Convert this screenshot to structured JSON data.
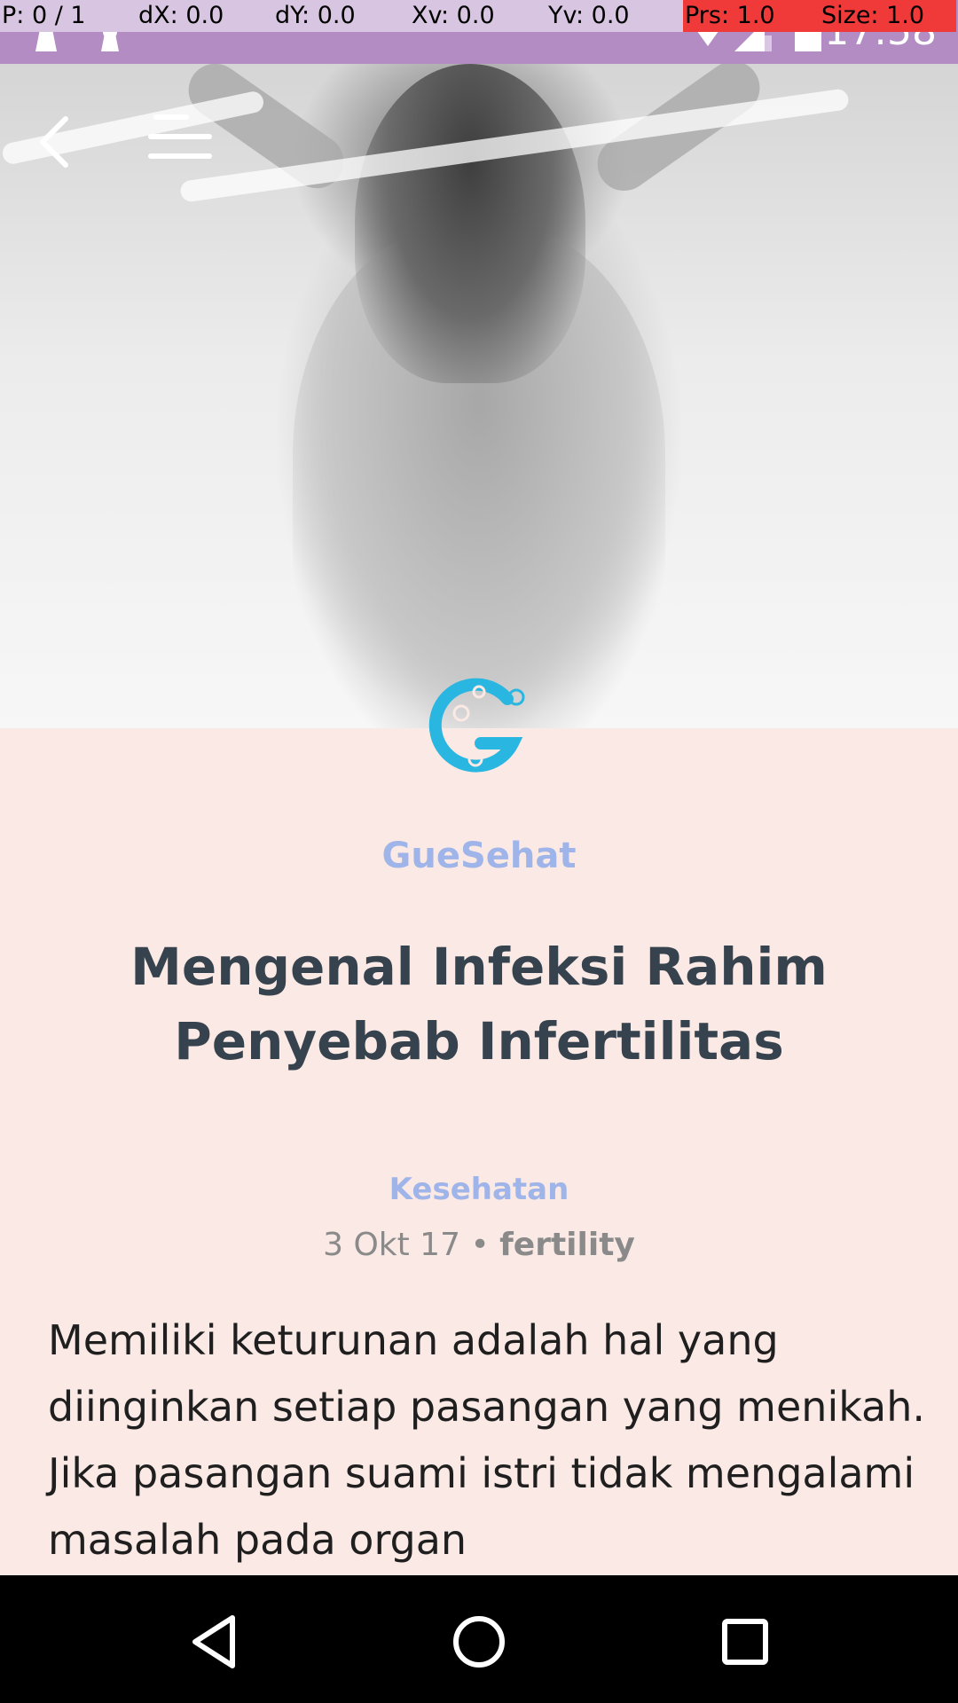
{
  "pointer_overlay": {
    "cells": [
      {
        "text": "P: 0 / 1",
        "highlight": false
      },
      {
        "text": "dX: 0.0",
        "highlight": false
      },
      {
        "text": "dY: 0.0",
        "highlight": false
      },
      {
        "text": "Xv: 0.0",
        "highlight": false
      },
      {
        "text": "Yv: 0.0",
        "highlight": false
      },
      {
        "text": "Prs: 1.0",
        "highlight": true
      },
      {
        "text": "Size: 1.0",
        "highlight": true
      }
    ]
  },
  "status_bar": {
    "time": "17:58",
    "color": "#b48cc4"
  },
  "article": {
    "brand": "GueSehat",
    "title": "Mengenal Infeksi Rahim Penyebab Infertilitas",
    "category": "Kesehatan",
    "date": "3 Okt 17",
    "separator": "•",
    "tag": "fertility",
    "body": "Memiliki keturunan adalah hal yang diinginkan setiap pasangan yang menikah. Jika pasangan suami istri tidak mengalami masalah pada organ"
  },
  "colors": {
    "background": "#fae9e4",
    "accent": "#9fb4e8",
    "title": "#36434e",
    "logo": "#29b6e0"
  },
  "icons": {
    "back": "back-arrow-icon",
    "menu": "hamburger-menu-icon",
    "logo": "guesehat-logo-icon",
    "nav_back": "nav-back-icon",
    "nav_home": "nav-home-icon",
    "nav_recents": "nav-recents-icon"
  }
}
